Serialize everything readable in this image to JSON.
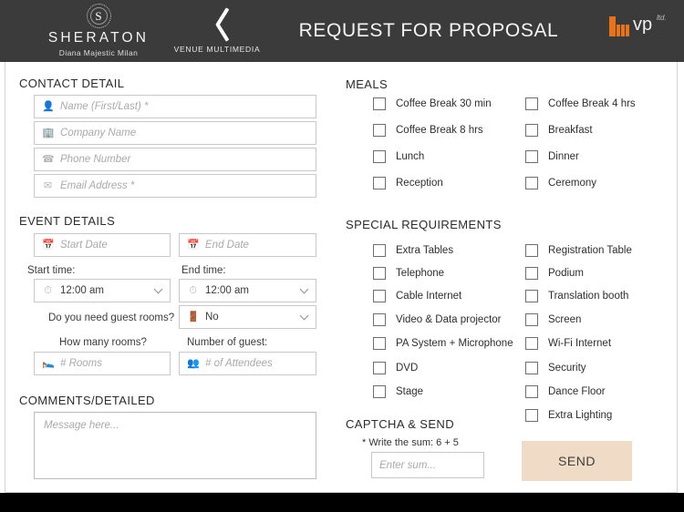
{
  "header": {
    "brand": {
      "seal_letter": "S",
      "name": "SHERATON",
      "sub": "Diana Majestic Milan"
    },
    "venue_nav": {
      "label": "VENUE MULTIMEDIA",
      "icon": "chevron-left-icon"
    },
    "title": "REQUEST FOR PROPOSAL",
    "vp_logo": {
      "text": "vp",
      "sup": "ltd.",
      "accent": "#e8731a"
    }
  },
  "contact": {
    "heading": "CONTACT DETAIL",
    "fields": [
      {
        "icon": "person-icon",
        "placeholder": "Name (First/Last) *"
      },
      {
        "icon": "building-icon",
        "placeholder": "Company Name"
      },
      {
        "icon": "phone-icon",
        "placeholder": "Phone Number"
      },
      {
        "icon": "envelope-icon",
        "placeholder": "Email Address *"
      }
    ]
  },
  "event": {
    "heading": "EVENT DETAILS",
    "start_date_placeholder": "Start Date",
    "end_date_placeholder": "End Date",
    "start_time_label": "Start time:",
    "end_time_label": "End time:",
    "start_time_value": "12:00 am",
    "end_time_value": "12:00 am",
    "guest_rooms_question": "Do you need guest rooms?",
    "guest_rooms_value": "No",
    "how_many_rooms_label": "How many rooms?",
    "number_of_guest_label": "Number of guest:",
    "rooms_placeholder": "# Rooms",
    "attendees_placeholder": "# of Attendees"
  },
  "comments": {
    "heading": "COMMENTS/DETAILED",
    "placeholder": "Message here..."
  },
  "meals": {
    "heading": "MEALS",
    "left": [
      "Coffee Break 30 min",
      "Coffee Break 8 hrs",
      "Lunch",
      "Reception"
    ],
    "right": [
      "Coffee Break 4 hrs",
      "Breakfast",
      "Dinner",
      "Ceremony"
    ]
  },
  "special": {
    "heading": "SPECIAL REQUIREMENTS",
    "left": [
      "Extra Tables",
      "Telephone",
      "Cable Internet",
      "Video & Data projector",
      "PA System + Microphone",
      "DVD",
      "Stage"
    ],
    "right": [
      "Registration Table",
      "Podium",
      "Translation booth",
      "Screen",
      "Wi-Fi Internet",
      "Security",
      "Dance Floor",
      "Extra Lighting"
    ]
  },
  "captcha": {
    "heading": "CAPTCHA & SEND",
    "question": "* Write the sum: 6 + 5",
    "placeholder": "Enter sum...",
    "send_label": "SEND",
    "send_color": "#f0dcc6"
  }
}
